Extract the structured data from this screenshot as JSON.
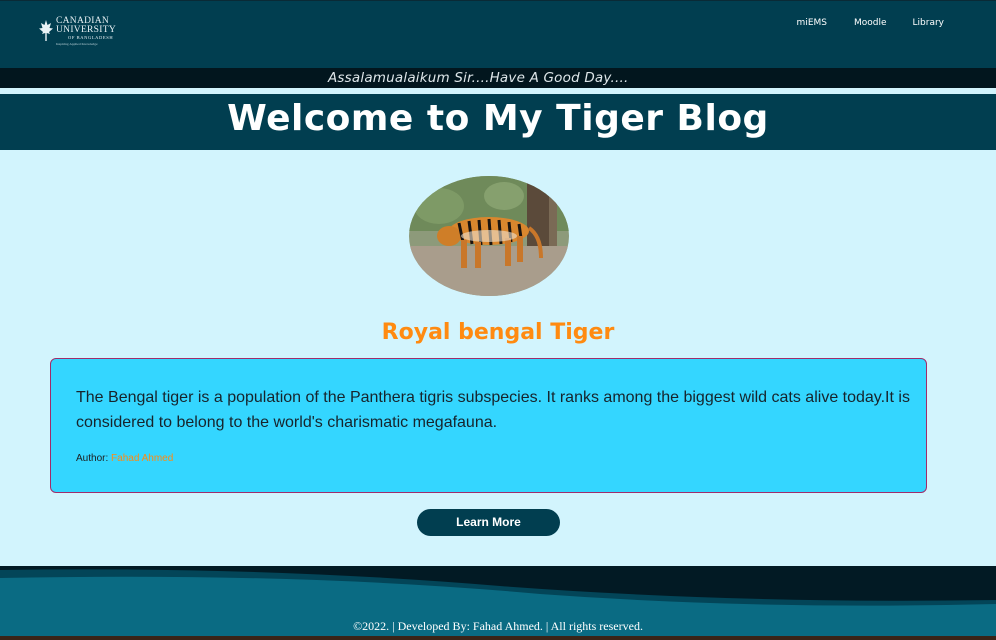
{
  "header": {
    "logo": {
      "line1": "CANADIAN",
      "line2": "UNIVERSITY",
      "line3": "OF BANGLADESH",
      "tagline": "Inspiring Applied Knowledge"
    },
    "nav": [
      {
        "label": "miEMS"
      },
      {
        "label": "Moodle"
      },
      {
        "label": "Library"
      }
    ]
  },
  "marquee": {
    "text": "Assalamualaikum Sir....Have A Good Day...."
  },
  "banner": {
    "title": "Welcome to My Tiger Blog"
  },
  "main": {
    "subtitle": "Royal bengal Tiger",
    "card": {
      "body": "The Bengal tiger is a population of the Panthera tigris subspecies. It ranks among the biggest wild cats alive today.It is considered to belong to the world's charismatic megafauna.",
      "author_label": "Author:",
      "author_name": "Fahad Ahmed"
    },
    "button_label": "Learn More"
  },
  "footer": {
    "text": "©2022. | Developed By: Fahad Ahmed. | All rights reserved."
  },
  "colors": {
    "nav_bg": "#013e50",
    "page_bg": "#d2f4fd",
    "card_bg": "#34d6ff",
    "accent_orange": "#ff8a10",
    "footer_bg": "#0a6b83"
  }
}
